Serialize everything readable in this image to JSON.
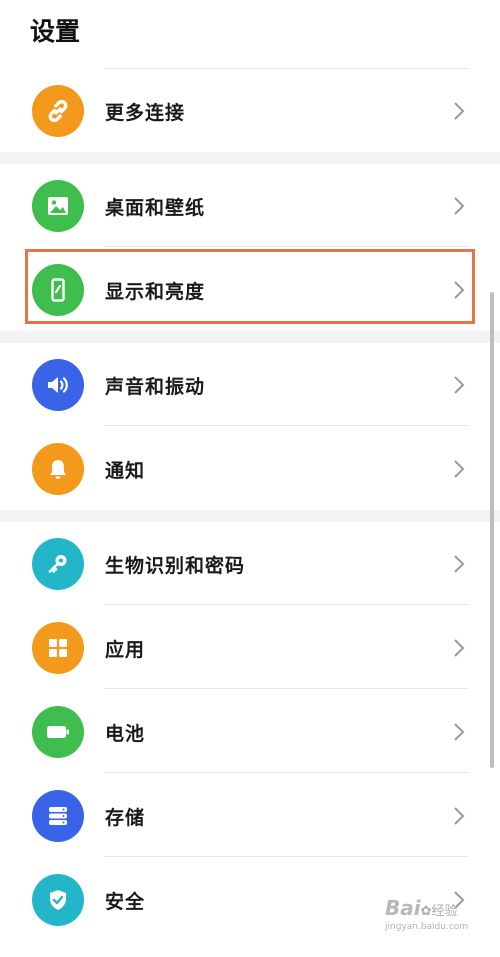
{
  "header": {
    "title": "设置"
  },
  "colors": {
    "orange": "#f39a1c",
    "green": "#3fbd4e",
    "blue": "#3a64e8",
    "cyan": "#23b6c9",
    "highlight": "#e8744a"
  },
  "items": [
    {
      "label": "更多连接",
      "icon": "link-icon"
    },
    {
      "label": "桌面和壁纸",
      "icon": "image-icon"
    },
    {
      "label": "显示和亮度",
      "icon": "display-brightness-icon"
    },
    {
      "label": "声音和振动",
      "icon": "speaker-icon"
    },
    {
      "label": "通知",
      "icon": "bell-icon"
    },
    {
      "label": "生物识别和密码",
      "icon": "key-icon"
    },
    {
      "label": "应用",
      "icon": "apps-grid-icon"
    },
    {
      "label": "电池",
      "icon": "battery-icon"
    },
    {
      "label": "存储",
      "icon": "storage-icon"
    },
    {
      "label": "安全",
      "icon": "shield-check-icon"
    }
  ],
  "watermark": {
    "brand": "Bai",
    "brand_suffix": "经验",
    "url": "jingyan.baidu.com"
  }
}
